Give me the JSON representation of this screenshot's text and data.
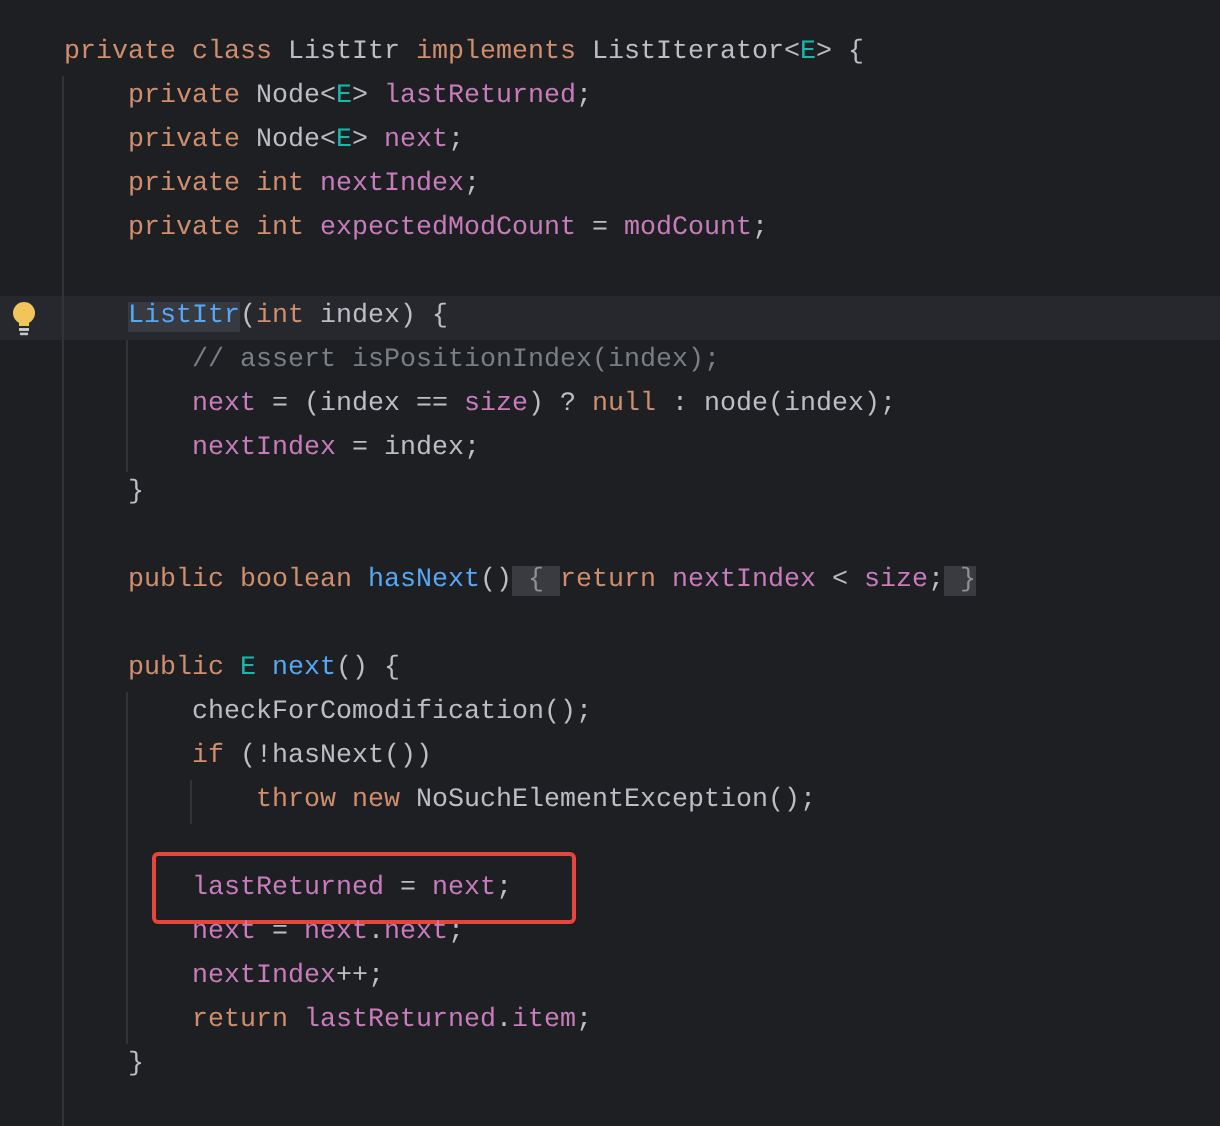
{
  "lines": [
    {
      "current": false,
      "intention": false,
      "boxed": false,
      "tokens": [
        {
          "kind": "kw",
          "text": "private class "
        },
        {
          "kind": "plain",
          "text": "ListItr "
        },
        {
          "kind": "kw",
          "text": "implements "
        },
        {
          "kind": "plain",
          "text": "ListIterator<"
        },
        {
          "kind": "param",
          "text": "E"
        },
        {
          "kind": "plain",
          "text": "> {"
        }
      ],
      "children": [
        {
          "current": false,
          "intention": false,
          "boxed": false,
          "tokens": [
            {
              "kind": "kw",
              "text": "private "
            },
            {
              "kind": "plain",
              "text": "Node<"
            },
            {
              "kind": "param",
              "text": "E"
            },
            {
              "kind": "plain",
              "text": "> "
            },
            {
              "kind": "field",
              "text": "lastReturned"
            },
            {
              "kind": "plain",
              "text": ";"
            }
          ]
        },
        {
          "current": false,
          "intention": false,
          "boxed": false,
          "tokens": [
            {
              "kind": "kw",
              "text": "private "
            },
            {
              "kind": "plain",
              "text": "Node<"
            },
            {
              "kind": "param",
              "text": "E"
            },
            {
              "kind": "plain",
              "text": "> "
            },
            {
              "kind": "field",
              "text": "next"
            },
            {
              "kind": "plain",
              "text": ";"
            }
          ]
        },
        {
          "current": false,
          "intention": false,
          "boxed": false,
          "tokens": [
            {
              "kind": "kw",
              "text": "private int "
            },
            {
              "kind": "field",
              "text": "nextIndex"
            },
            {
              "kind": "plain",
              "text": ";"
            }
          ]
        },
        {
          "current": false,
          "intention": false,
          "boxed": false,
          "tokens": [
            {
              "kind": "kw",
              "text": "private int "
            },
            {
              "kind": "field",
              "text": "expectedModCount"
            },
            {
              "kind": "plain",
              "text": " = "
            },
            {
              "kind": "field",
              "text": "modCount"
            },
            {
              "kind": "plain",
              "text": ";"
            }
          ]
        },
        {
          "kind": "blank"
        },
        {
          "current": true,
          "intention": true,
          "boxed": false,
          "tokens": [
            {
              "kind": "usage",
              "text": "ListItr"
            },
            {
              "kind": "plain",
              "text": "("
            },
            {
              "kind": "kw",
              "text": "int "
            },
            {
              "kind": "plain",
              "text": "index) {"
            }
          ],
          "children": [
            {
              "current": false,
              "intention": false,
              "boxed": false,
              "tokens": [
                {
                  "kind": "comment",
                  "text": "// assert isPositionIndex(index);"
                }
              ]
            },
            {
              "current": false,
              "intention": false,
              "boxed": false,
              "tokens": [
                {
                  "kind": "field",
                  "text": "next"
                },
                {
                  "kind": "plain",
                  "text": " = (index == "
                },
                {
                  "kind": "field",
                  "text": "size"
                },
                {
                  "kind": "plain",
                  "text": ") ? "
                },
                {
                  "kind": "kw",
                  "text": "null"
                },
                {
                  "kind": "plain",
                  "text": " : node(index);"
                }
              ]
            },
            {
              "current": false,
              "intention": false,
              "boxed": false,
              "tokens": [
                {
                  "kind": "field",
                  "text": "nextIndex"
                },
                {
                  "kind": "plain",
                  "text": " = index;"
                }
              ]
            }
          ]
        },
        {
          "current": false,
          "intention": false,
          "boxed": false,
          "tokens": [
            {
              "kind": "plain",
              "text": "}"
            }
          ]
        },
        {
          "kind": "blank"
        },
        {
          "current": false,
          "intention": false,
          "boxed": false,
          "tokens": [
            {
              "kind": "kw",
              "text": "public boolean "
            },
            {
              "kind": "method",
              "text": "hasNext"
            },
            {
              "kind": "plain",
              "text": "()"
            },
            {
              "kind": "fold",
              "text": " { "
            },
            {
              "kind": "kw",
              "text": "return "
            },
            {
              "kind": "field",
              "text": "nextIndex"
            },
            {
              "kind": "plain",
              "text": " < "
            },
            {
              "kind": "field",
              "text": "size"
            },
            {
              "kind": "plain",
              "text": ";"
            },
            {
              "kind": "fold",
              "text": " }"
            }
          ]
        },
        {
          "kind": "blank"
        },
        {
          "current": false,
          "intention": false,
          "boxed": false,
          "tokens": [
            {
              "kind": "kw",
              "text": "public "
            },
            {
              "kind": "param",
              "text": "E "
            },
            {
              "kind": "method",
              "text": "next"
            },
            {
              "kind": "plain",
              "text": "() {"
            }
          ],
          "children": [
            {
              "current": false,
              "intention": false,
              "boxed": false,
              "tokens": [
                {
                  "kind": "plain",
                  "text": "checkForComodification();"
                }
              ]
            },
            {
              "current": false,
              "intention": false,
              "boxed": false,
              "tokens": [
                {
                  "kind": "kw",
                  "text": "if "
                },
                {
                  "kind": "plain",
                  "text": "(!hasNext())"
                }
              ],
              "children": [
                {
                  "current": false,
                  "intention": false,
                  "boxed": false,
                  "tokens": [
                    {
                      "kind": "kw",
                      "text": "throw new "
                    },
                    {
                      "kind": "plain",
                      "text": "NoSuchElementException();"
                    }
                  ]
                }
              ]
            },
            {
              "kind": "blank"
            },
            {
              "current": false,
              "intention": false,
              "boxed": true,
              "tokens": [
                {
                  "kind": "field",
                  "text": "lastReturned"
                },
                {
                  "kind": "plain",
                  "text": " = "
                },
                {
                  "kind": "field",
                  "text": "next"
                },
                {
                  "kind": "plain",
                  "text": ";"
                }
              ]
            },
            {
              "current": false,
              "intention": false,
              "boxed": false,
              "tokens": [
                {
                  "kind": "field",
                  "text": "next"
                },
                {
                  "kind": "plain",
                  "text": " = "
                },
                {
                  "kind": "field",
                  "text": "next"
                },
                {
                  "kind": "plain",
                  "text": "."
                },
                {
                  "kind": "field",
                  "text": "next"
                },
                {
                  "kind": "plain",
                  "text": ";"
                }
              ]
            },
            {
              "current": false,
              "intention": false,
              "boxed": false,
              "tokens": [
                {
                  "kind": "field",
                  "text": "nextIndex"
                },
                {
                  "kind": "plain",
                  "text": "++;"
                }
              ]
            },
            {
              "current": false,
              "intention": false,
              "boxed": false,
              "tokens": [
                {
                  "kind": "kw",
                  "text": "return "
                },
                {
                  "kind": "field",
                  "text": "lastReturned"
                },
                {
                  "kind": "plain",
                  "text": "."
                },
                {
                  "kind": "field",
                  "text": "item"
                },
                {
                  "kind": "plain",
                  "text": ";"
                }
              ]
            }
          ]
        },
        {
          "current": false,
          "intention": false,
          "boxed": false,
          "tokens": [
            {
              "kind": "plain",
              "text": "}"
            }
          ]
        },
        {
          "kind": "blank"
        }
      ]
    }
  ]
}
